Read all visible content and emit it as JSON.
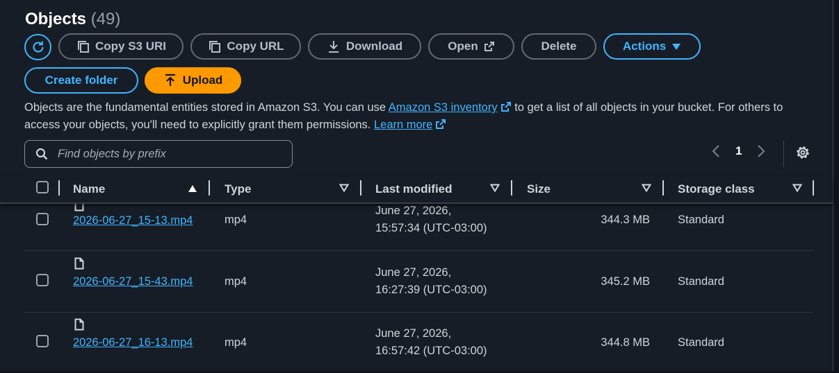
{
  "header": {
    "title": "Objects",
    "count": "(49)"
  },
  "toolbar": {
    "copy_s3_uri": "Copy S3 URI",
    "copy_url": "Copy URL",
    "download": "Download",
    "open": "Open",
    "delete": "Delete",
    "actions": "Actions",
    "create_folder": "Create folder",
    "upload": "Upload"
  },
  "description": {
    "part1": "Objects are the fundamental entities stored in Amazon S3. You can use ",
    "link1": "Amazon S3 inventory",
    "part2": " to get a list of all objects in your bucket. For others to access your objects, you'll need to explicitly grant them permissions. ",
    "link2": "Learn more"
  },
  "search": {
    "placeholder": "Find objects by prefix",
    "value": ""
  },
  "pagination": {
    "current_page": "1"
  },
  "table": {
    "columns": [
      "Name",
      "Type",
      "Last modified",
      "Size",
      "Storage class"
    ],
    "rows": [
      {
        "name": "2026-06-27_15-13.mp4",
        "type": "mp4",
        "date_line1": "June 27, 2026,",
        "date_line2": "15:57:34 (UTC-03:00)",
        "size": "344.3 MB",
        "storage_class": "Standard"
      },
      {
        "name": "2026-06-27_15-43.mp4",
        "type": "mp4",
        "date_line1": "June 27, 2026,",
        "date_line2": "16:27:39 (UTC-03:00)",
        "size": "345.2 MB",
        "storage_class": "Standard"
      },
      {
        "name": "2026-06-27_16-13.mp4",
        "type": "mp4",
        "date_line1": "June 27, 2026,",
        "date_line2": "16:57:42 (UTC-03:00)",
        "size": "344.8 MB",
        "storage_class": "Standard"
      }
    ]
  },
  "colors": {
    "accent": "#42b4ff",
    "upload": "#ff9900",
    "background": "#161d26"
  },
  "icons": [
    "refresh-icon",
    "copy-icon",
    "download-icon",
    "external-link-icon",
    "caret-down-icon",
    "upload-icon",
    "search-icon",
    "chevron-left-icon",
    "chevron-right-icon",
    "settings-icon",
    "sort-ascending-icon",
    "sort-icon",
    "file-icon"
  ]
}
